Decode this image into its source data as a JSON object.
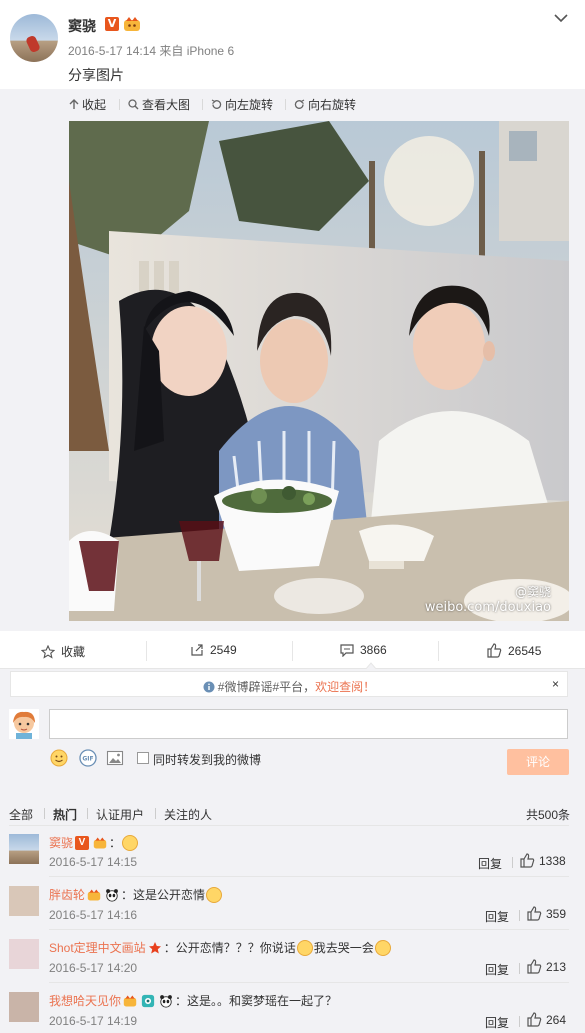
{
  "post": {
    "author": "窦骁",
    "verified_badge": "V",
    "meta": "2016-5-17 14:14 来自 iPhone 6",
    "text": "分享图片"
  },
  "media_toolbar": {
    "collapse": "收起",
    "view_large": "查看大图",
    "rotate_left": "向左旋转",
    "rotate_right": "向右旋转"
  },
  "photo": {
    "watermark": "weibo.com/douxiao",
    "watermark_name": "@窦骁"
  },
  "actions": {
    "favorite": "收藏",
    "repost_count": "2549",
    "comment_count": "3866",
    "like_count": "26545"
  },
  "notice": {
    "tag": "#微博辟谣#平台",
    "link": "欢迎查阅！",
    "close": "×"
  },
  "compose": {
    "placeholder": "",
    "repost_label": "同时转发到我的微博",
    "submit": "评论"
  },
  "filters": {
    "all": "全部",
    "hot": "热门",
    "verified": "认证用户",
    "following": "关注的人",
    "total": "共500条"
  },
  "comments": [
    {
      "name": "窦骁",
      "text": "：",
      "time": "2016-5-17 14:15",
      "reply": "回复",
      "likes": "1338"
    },
    {
      "name": "胖齿轮",
      "text": "：这是公开恋情",
      "time": "2016-5-17 14:16",
      "reply": "回复",
      "likes": "359"
    },
    {
      "name": "Shot定理中文画站",
      "text": "：公开恋情？？？你说话",
      "text2": "我去哭一会",
      "time": "2016-5-17 14:20",
      "reply": "回复",
      "likes": "213"
    },
    {
      "name": "我想哈天见你",
      "text": "：这是。。和窦梦瑶在一起了？",
      "time": "2016-5-17 14:19",
      "reply": "回复",
      "likes": "264"
    }
  ],
  "colors": {
    "link": "#eb7350",
    "submit_bg": "#ffc09f",
    "panel_bg": "#f2f2f5"
  }
}
